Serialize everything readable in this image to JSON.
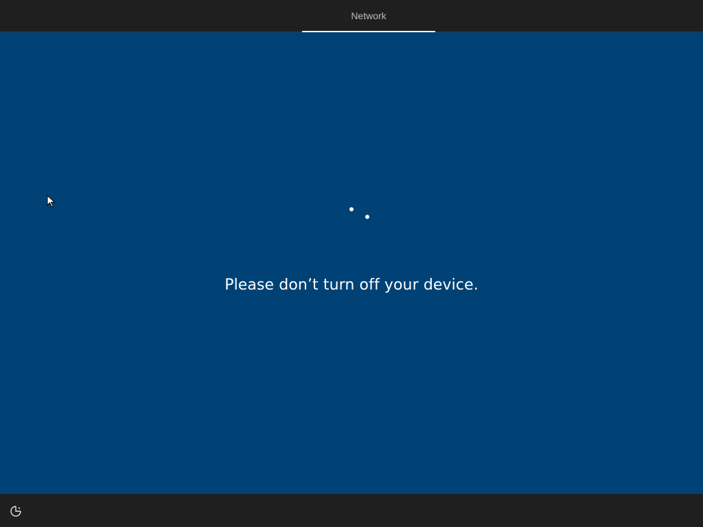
{
  "header": {
    "active_tab_label": "Network"
  },
  "main": {
    "message": "Please don’t turn off your device.",
    "spinner_icon": "loading-dots-icon",
    "background_color": "#004275"
  },
  "footer": {
    "accessibility_icon": "ease-of-access-icon"
  }
}
